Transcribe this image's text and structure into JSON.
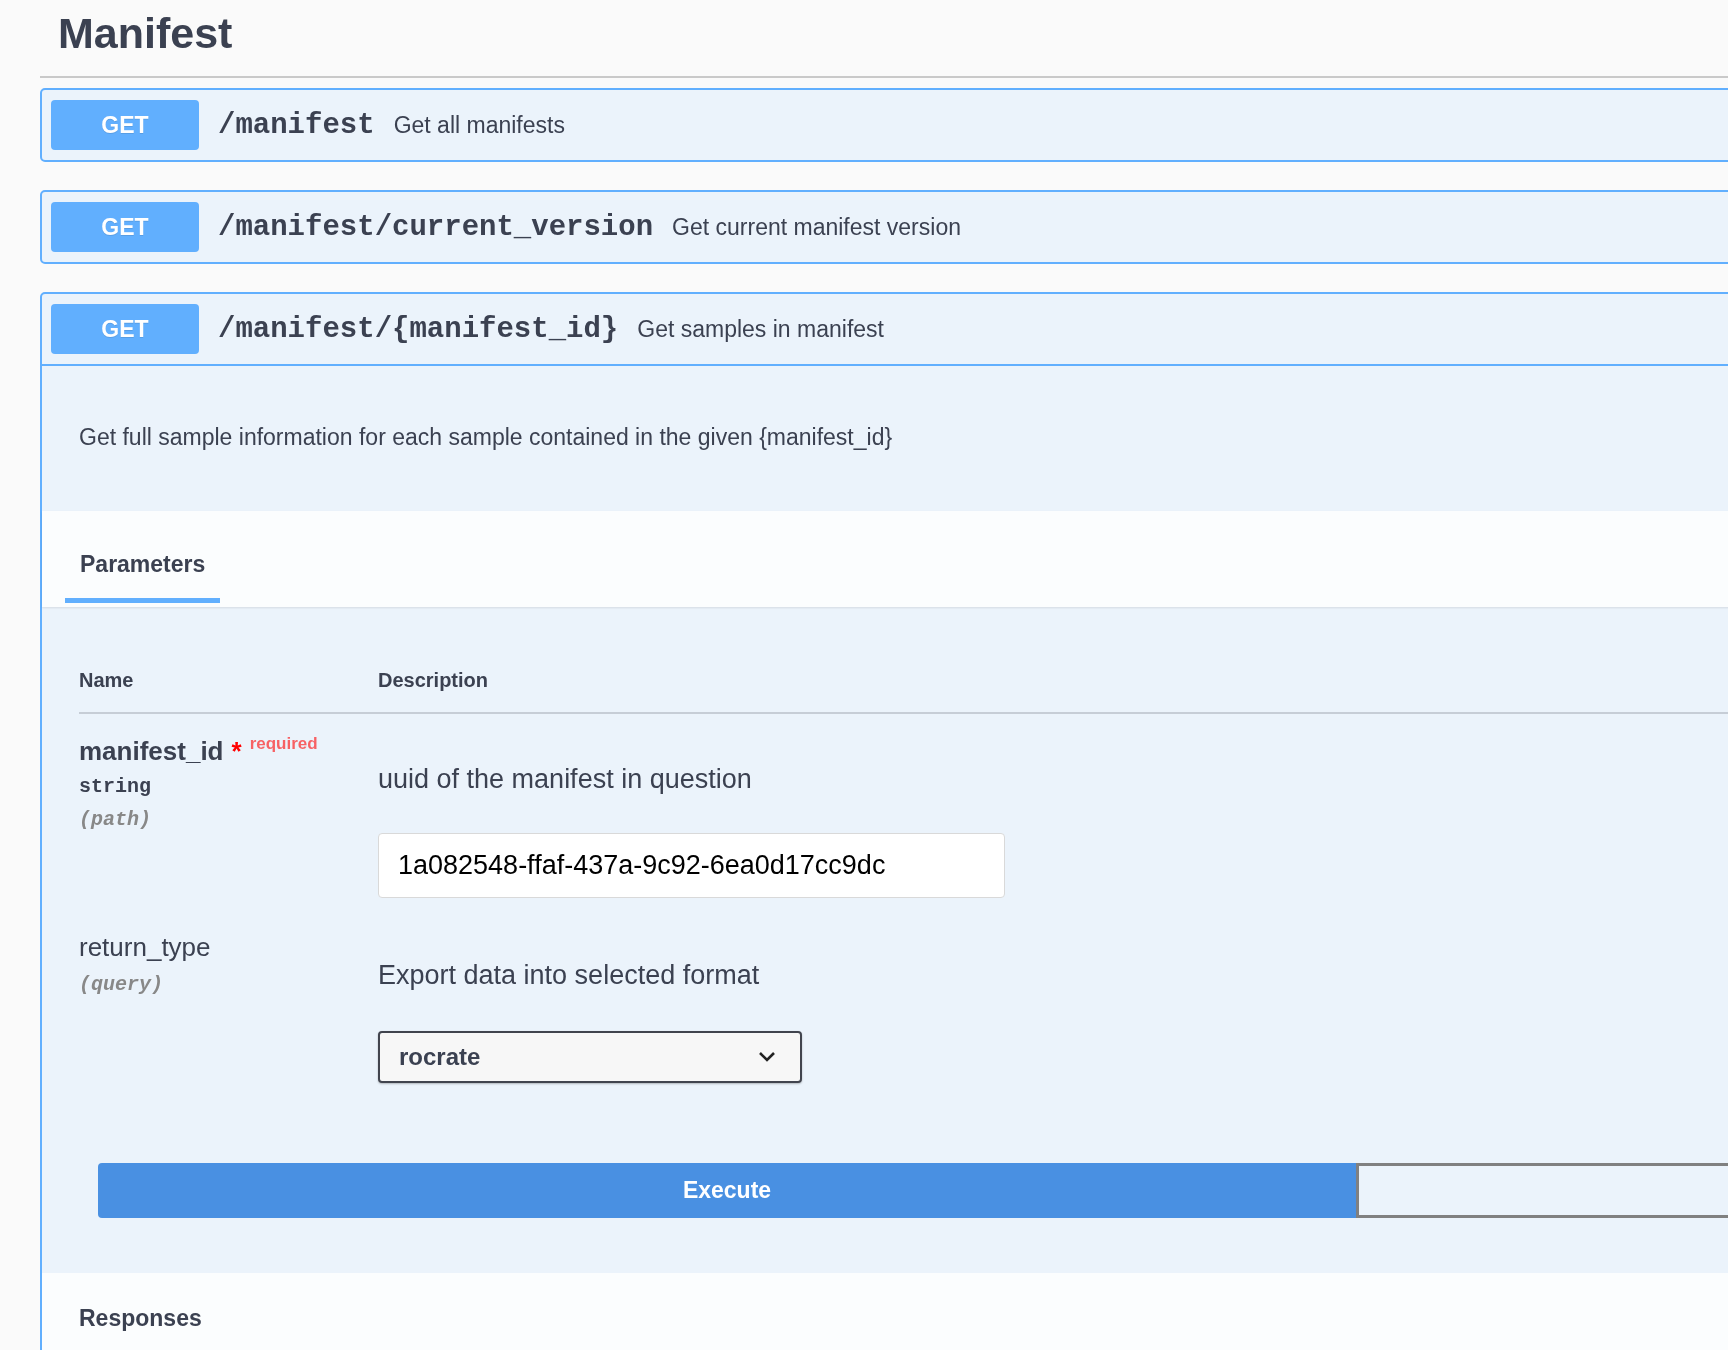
{
  "section": {
    "title": "Manifest"
  },
  "operations": [
    {
      "method": "GET",
      "path": "/manifest",
      "summary": "Get all manifests",
      "expanded": false
    },
    {
      "method": "GET",
      "path": "/manifest/current_version",
      "summary": "Get current manifest version",
      "expanded": false
    },
    {
      "method": "GET",
      "path": "/manifest/{manifest_id}",
      "summary": "Get samples in manifest",
      "expanded": true,
      "description": "Get full sample information for each sample contained in the given {manifest_id}",
      "tabs": [
        {
          "label": "Parameters",
          "selected": true
        }
      ],
      "columns": [
        "Name",
        "Description"
      ],
      "parameters": [
        {
          "name": "manifest_id",
          "required": true,
          "required_mark": "*",
          "required_label": "required",
          "type": "string",
          "location": "(path)",
          "description": "uuid of the manifest in question",
          "kind": "input",
          "value": "1a082548-ffaf-437a-9c92-6ea0d17cc9dc"
        },
        {
          "name": "return_type",
          "required": false,
          "location": "(query)",
          "description": "Export data into selected format",
          "kind": "select",
          "value": "rocrate"
        }
      ],
      "execute": "Execute",
      "responses": "Responses"
    }
  ]
}
